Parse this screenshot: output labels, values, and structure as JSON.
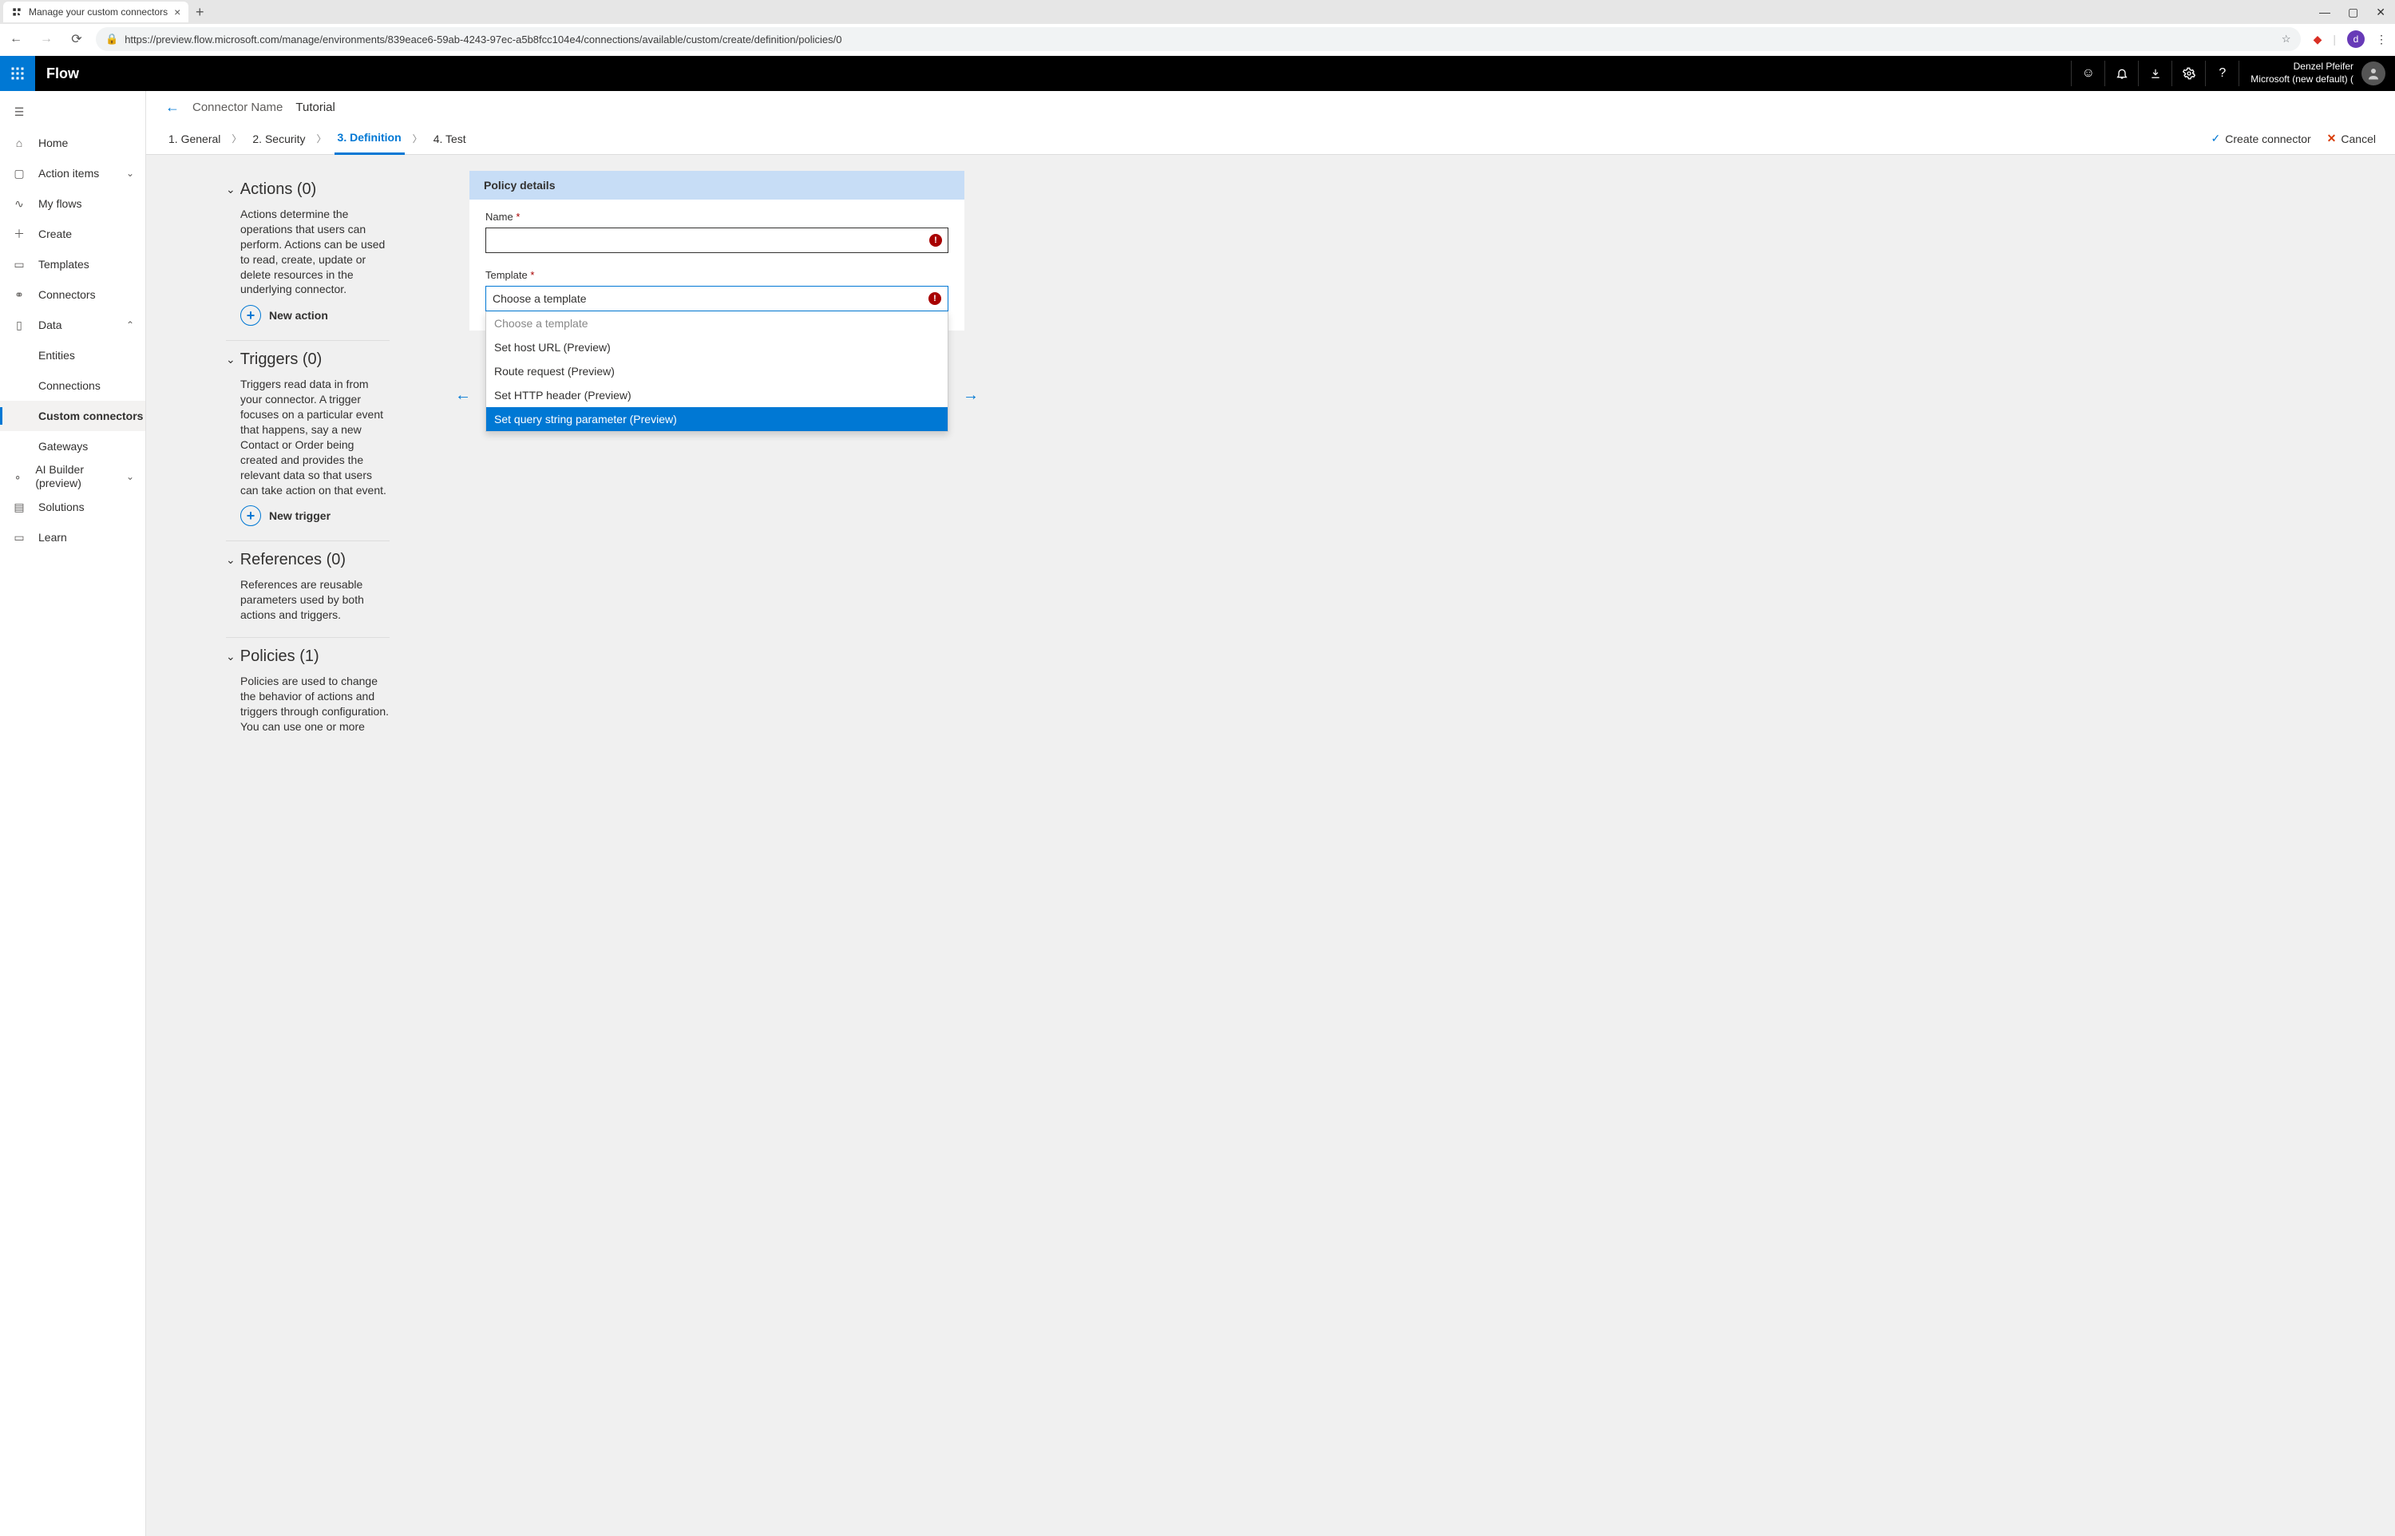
{
  "browser": {
    "tab_title": "Manage your custom connectors",
    "url": "https://preview.flow.microsoft.com/manage/environments/839eace6-59ab-4243-97ec-a5b8fcc104e4/connections/available/custom/create/definition/policies/0",
    "avatar_letter": "d"
  },
  "header": {
    "app_name": "Flow",
    "user_name": "Denzel Pfeifer",
    "tenant": "Microsoft (new default) ("
  },
  "sidebar": {
    "items": [
      {
        "label": "Home"
      },
      {
        "label": "Action items"
      },
      {
        "label": "My flows"
      },
      {
        "label": "Create"
      },
      {
        "label": "Templates"
      },
      {
        "label": "Connectors"
      },
      {
        "label": "Data"
      },
      {
        "label": "Entities"
      },
      {
        "label": "Connections"
      },
      {
        "label": "Custom connectors"
      },
      {
        "label": "Gateways"
      },
      {
        "label": "AI Builder (preview)"
      },
      {
        "label": "Solutions"
      },
      {
        "label": "Learn"
      }
    ]
  },
  "page": {
    "breadcrumb_label": "Connector Name",
    "connector_name": "Tutorial",
    "steps": [
      "1. General",
      "2. Security",
      "3. Definition",
      "4. Test"
    ],
    "create_label": "Create connector",
    "cancel_label": "Cancel"
  },
  "definition": {
    "actions": {
      "title": "Actions (0)",
      "desc": "Actions determine the operations that users can perform. Actions can be used to read, create, update or delete resources in the underlying connector.",
      "button": "New action"
    },
    "triggers": {
      "title": "Triggers (0)",
      "desc": "Triggers read data in from your connector. A trigger focuses on a particular event that happens, say a new Contact or Order being created and provides the relevant data so that users can take action on that event.",
      "button": "New trigger"
    },
    "references": {
      "title": "References (0)",
      "desc": "References are reusable parameters used by both actions and triggers."
    },
    "policies": {
      "title": "Policies (1)",
      "desc": "Policies are used to change the behavior of actions and triggers through configuration. You can use one or more"
    }
  },
  "policy": {
    "panel_title": "Policy details",
    "name_label": "Name",
    "template_label": "Template",
    "template_value": "Choose a template",
    "options": [
      "Choose a template",
      "Set host URL (Preview)",
      "Route request (Preview)",
      "Set HTTP header (Preview)",
      "Set query string parameter (Preview)"
    ]
  }
}
